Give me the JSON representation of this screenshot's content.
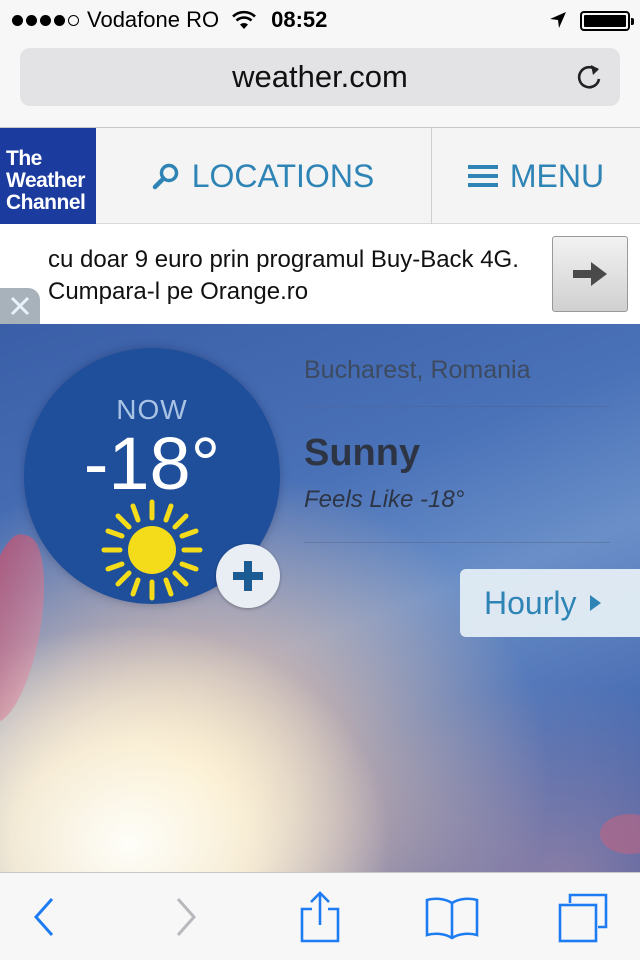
{
  "status_bar": {
    "carrier": "Vodafone RO",
    "time": "08:52"
  },
  "browser": {
    "url": "weather.com"
  },
  "header": {
    "logo_lines": [
      "The",
      "Weather",
      "Channel"
    ],
    "locations_label": "LOCATIONS",
    "menu_label": "MENU"
  },
  "ad": {
    "text": "cu doar 9 euro prin programul Buy-Back 4G. Cumpara-l pe Orange.ro"
  },
  "weather": {
    "now_label": "NOW",
    "temperature": "-18°",
    "location": "Bucharest, Romania",
    "condition": "Sunny",
    "feels_like": "Feels Like -18°",
    "hourly_label": "Hourly"
  },
  "icons": [
    "wifi-icon",
    "location-arrow-icon",
    "battery-icon",
    "reload-icon",
    "search-icon",
    "menu-icon",
    "arrow-right-icon",
    "close-icon",
    "sun-icon",
    "plus-icon",
    "back-icon",
    "forward-icon",
    "share-icon",
    "bookmarks-icon",
    "tabs-icon"
  ],
  "colors": {
    "accent": "#2f84b6",
    "logo_bg": "#1b3b9e",
    "now_circle": "#1f4f9a",
    "sun": "#f5dc1a"
  }
}
